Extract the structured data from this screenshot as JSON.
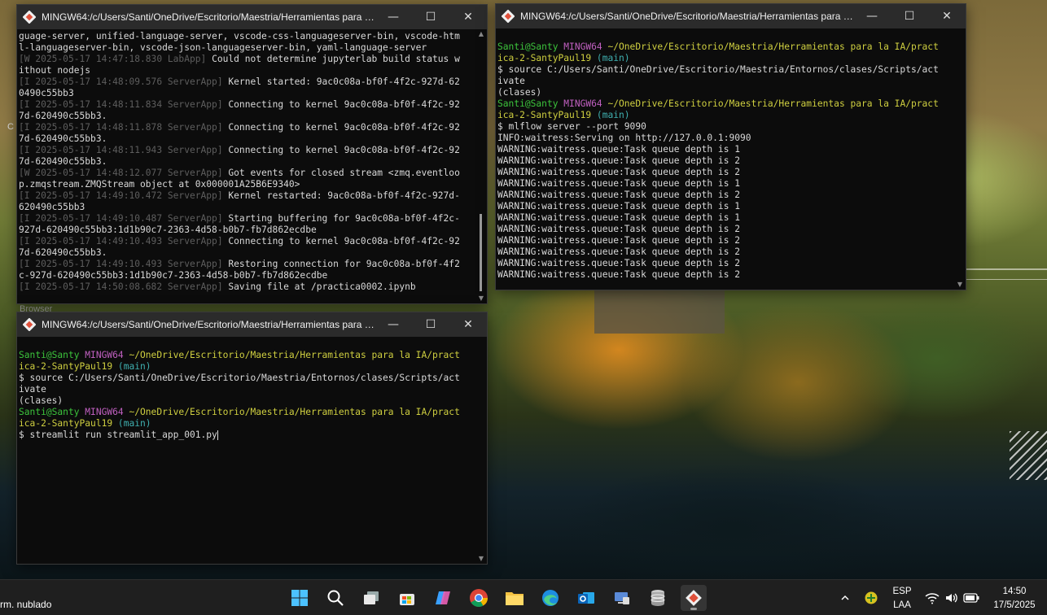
{
  "desktop": {
    "peek_left_c": "C",
    "peek_browser": "Browser",
    "peek_weather": "rm. nublado"
  },
  "windows": {
    "jupyter": {
      "title": "MINGW64:/c/Users/Santi/OneDrive/Escritorio/Maestria/Herramientas para l...",
      "lines": [
        [
          {
            "t": "guage-server, unified-language-server, vscode-css-languageserver-bin, vscode-htm",
            "c": ""
          }
        ],
        [
          {
            "t": "l-languageserver-bin, vscode-json-languageserver-bin, yaml-language-server",
            "c": ""
          }
        ],
        [
          {
            "t": "[W 2025-05-17 14:47:18.830 LabApp]",
            "c": "c-dgray"
          },
          {
            "t": " Could not determine jupyterlab build status w",
            "c": ""
          }
        ],
        [
          {
            "t": "ithout nodejs",
            "c": ""
          }
        ],
        [
          {
            "t": "[I 2025-05-17 14:48:09.576 ServerApp]",
            "c": "c-dgray"
          },
          {
            "t": " Kernel started: 9ac0c08a-bf0f-4f2c-927d-62",
            "c": ""
          }
        ],
        [
          {
            "t": "0490c55bb3",
            "c": ""
          }
        ],
        [
          {
            "t": "[I 2025-05-17 14:48:11.834 ServerApp]",
            "c": "c-dgray"
          },
          {
            "t": " Connecting to kernel 9ac0c08a-bf0f-4f2c-92",
            "c": ""
          }
        ],
        [
          {
            "t": "7d-620490c55bb3.",
            "c": ""
          }
        ],
        [
          {
            "t": "[I 2025-05-17 14:48:11.878 ServerApp]",
            "c": "c-dgray"
          },
          {
            "t": " Connecting to kernel 9ac0c08a-bf0f-4f2c-92",
            "c": ""
          }
        ],
        [
          {
            "t": "7d-620490c55bb3.",
            "c": ""
          }
        ],
        [
          {
            "t": "[I 2025-05-17 14:48:11.943 ServerApp]",
            "c": "c-dgray"
          },
          {
            "t": " Connecting to kernel 9ac0c08a-bf0f-4f2c-92",
            "c": ""
          }
        ],
        [
          {
            "t": "7d-620490c55bb3.",
            "c": ""
          }
        ],
        [
          {
            "t": "[W 2025-05-17 14:48:12.077 ServerApp]",
            "c": "c-dgray"
          },
          {
            "t": " Got events for closed stream <zmq.eventloo",
            "c": ""
          }
        ],
        [
          {
            "t": "p.zmqstream.ZMQStream object at 0x000001A25B6E9340>",
            "c": ""
          }
        ],
        [
          {
            "t": "[I 2025-05-17 14:49:10.472 ServerApp]",
            "c": "c-dgray"
          },
          {
            "t": " Kernel restarted: 9ac0c08a-bf0f-4f2c-927d-",
            "c": ""
          }
        ],
        [
          {
            "t": "620490c55bb3",
            "c": ""
          }
        ],
        [
          {
            "t": "[I 2025-05-17 14:49:10.487 ServerApp]",
            "c": "c-dgray"
          },
          {
            "t": " Starting buffering for 9ac0c08a-bf0f-4f2c-",
            "c": ""
          }
        ],
        [
          {
            "t": "927d-620490c55bb3:1d1b90c7-2363-4d58-b0b7-fb7d862ecdbe",
            "c": ""
          }
        ],
        [
          {
            "t": "[I 2025-05-17 14:49:10.493 ServerApp]",
            "c": "c-dgray"
          },
          {
            "t": " Connecting to kernel 9ac0c08a-bf0f-4f2c-92",
            "c": ""
          }
        ],
        [
          {
            "t": "7d-620490c55bb3.",
            "c": ""
          }
        ],
        [
          {
            "t": "[I 2025-05-17 14:49:10.493 ServerApp]",
            "c": "c-dgray"
          },
          {
            "t": " Restoring connection for 9ac0c08a-bf0f-4f2",
            "c": ""
          }
        ],
        [
          {
            "t": "c-927d-620490c55bb3:1d1b90c7-2363-4d58-b0b7-fb7d862ecdbe",
            "c": ""
          }
        ],
        [
          {
            "t": "[I 2025-05-17 14:50:08.682 ServerApp]",
            "c": "c-dgray"
          },
          {
            "t": " Saving file at /practica0002.ipynb",
            "c": ""
          }
        ]
      ]
    },
    "mlflow": {
      "title": "MINGW64:/c/Users/Santi/OneDrive/Escritorio/Maestria/Herramientas para l...",
      "lines": [
        [
          {
            "t": "",
            "c": ""
          }
        ],
        [
          {
            "t": "Santi@Santy ",
            "c": "c-green"
          },
          {
            "t": "MINGW64 ",
            "c": "c-mag"
          },
          {
            "t": "~/OneDrive/Escritorio/Maestria/Herramientas para la IA/pract",
            "c": "c-yel"
          }
        ],
        [
          {
            "t": "ica-2-SantyPaul19 ",
            "c": "c-yel"
          },
          {
            "t": "(main)",
            "c": "c-cyan"
          }
        ],
        [
          {
            "t": "$ source C:/Users/Santi/OneDrive/Escritorio/Maestria/Entornos/clases/Scripts/act",
            "c": ""
          }
        ],
        [
          {
            "t": "ivate",
            "c": ""
          }
        ],
        [
          {
            "t": "(clases)",
            "c": ""
          }
        ],
        [
          {
            "t": "Santi@Santy ",
            "c": "c-green"
          },
          {
            "t": "MINGW64 ",
            "c": "c-mag"
          },
          {
            "t": "~/OneDrive/Escritorio/Maestria/Herramientas para la IA/pract",
            "c": "c-yel"
          }
        ],
        [
          {
            "t": "ica-2-SantyPaul19 ",
            "c": "c-yel"
          },
          {
            "t": "(main)",
            "c": "c-cyan"
          }
        ],
        [
          {
            "t": "$ mlflow server --port 9090",
            "c": ""
          }
        ],
        [
          {
            "t": "INFO:waitress:Serving on http://127.0.0.1:9090",
            "c": ""
          }
        ],
        [
          {
            "t": "WARNING:waitress.queue:Task queue depth is 1",
            "c": ""
          }
        ],
        [
          {
            "t": "WARNING:waitress.queue:Task queue depth is 2",
            "c": ""
          }
        ],
        [
          {
            "t": "WARNING:waitress.queue:Task queue depth is 2",
            "c": ""
          }
        ],
        [
          {
            "t": "WARNING:waitress.queue:Task queue depth is 1",
            "c": ""
          }
        ],
        [
          {
            "t": "WARNING:waitress.queue:Task queue depth is 2",
            "c": ""
          }
        ],
        [
          {
            "t": "WARNING:waitress.queue:Task queue depth is 1",
            "c": ""
          }
        ],
        [
          {
            "t": "WARNING:waitress.queue:Task queue depth is 1",
            "c": ""
          }
        ],
        [
          {
            "t": "WARNING:waitress.queue:Task queue depth is 2",
            "c": ""
          }
        ],
        [
          {
            "t": "WARNING:waitress.queue:Task queue depth is 2",
            "c": ""
          }
        ],
        [
          {
            "t": "WARNING:waitress.queue:Task queue depth is 2",
            "c": ""
          }
        ],
        [
          {
            "t": "WARNING:waitress.queue:Task queue depth is 2",
            "c": ""
          }
        ],
        [
          {
            "t": "WARNING:waitress.queue:Task queue depth is 2",
            "c": ""
          }
        ]
      ]
    },
    "streamlit": {
      "title": "MINGW64:/c/Users/Santi/OneDrive/Escritorio/Maestria/Herramientas para l...",
      "lines": [
        [
          {
            "t": "",
            "c": ""
          }
        ],
        [
          {
            "t": "Santi@Santy ",
            "c": "c-green"
          },
          {
            "t": "MINGW64 ",
            "c": "c-mag"
          },
          {
            "t": "~/OneDrive/Escritorio/Maestria/Herramientas para la IA/pract",
            "c": "c-yel"
          }
        ],
        [
          {
            "t": "ica-2-SantyPaul19 ",
            "c": "c-yel"
          },
          {
            "t": "(main)",
            "c": "c-cyan"
          }
        ],
        [
          {
            "t": "$ source C:/Users/Santi/OneDrive/Escritorio/Maestria/Entornos/clases/Scripts/act",
            "c": ""
          }
        ],
        [
          {
            "t": "ivate",
            "c": ""
          }
        ],
        [
          {
            "t": "(clases)",
            "c": ""
          }
        ],
        [
          {
            "t": "Santi@Santy ",
            "c": "c-green"
          },
          {
            "t": "MINGW64 ",
            "c": "c-mag"
          },
          {
            "t": "~/OneDrive/Escritorio/Maestria/Herramientas para la IA/pract",
            "c": "c-yel"
          }
        ],
        [
          {
            "t": "ica-2-SantyPaul19 ",
            "c": "c-yel"
          },
          {
            "t": "(main)",
            "c": "c-cyan"
          }
        ],
        [
          {
            "t": "$ streamlit run streamlit_app_001.py",
            "c": ""
          }
        ]
      ]
    }
  },
  "taskbar": {
    "apps": [
      "windows-start-icon",
      "search-icon",
      "task-view-icon",
      "microsoft-store-icon",
      "copilot-icon",
      "chrome-icon",
      "file-explorer-icon",
      "edge-icon",
      "outlook-icon",
      "remote-desktop-icon",
      "database-icon",
      "git-bash-icon"
    ],
    "language_top": "ESP",
    "language_bottom": "LAA",
    "time": "14:50",
    "date": "17/5/2025"
  }
}
